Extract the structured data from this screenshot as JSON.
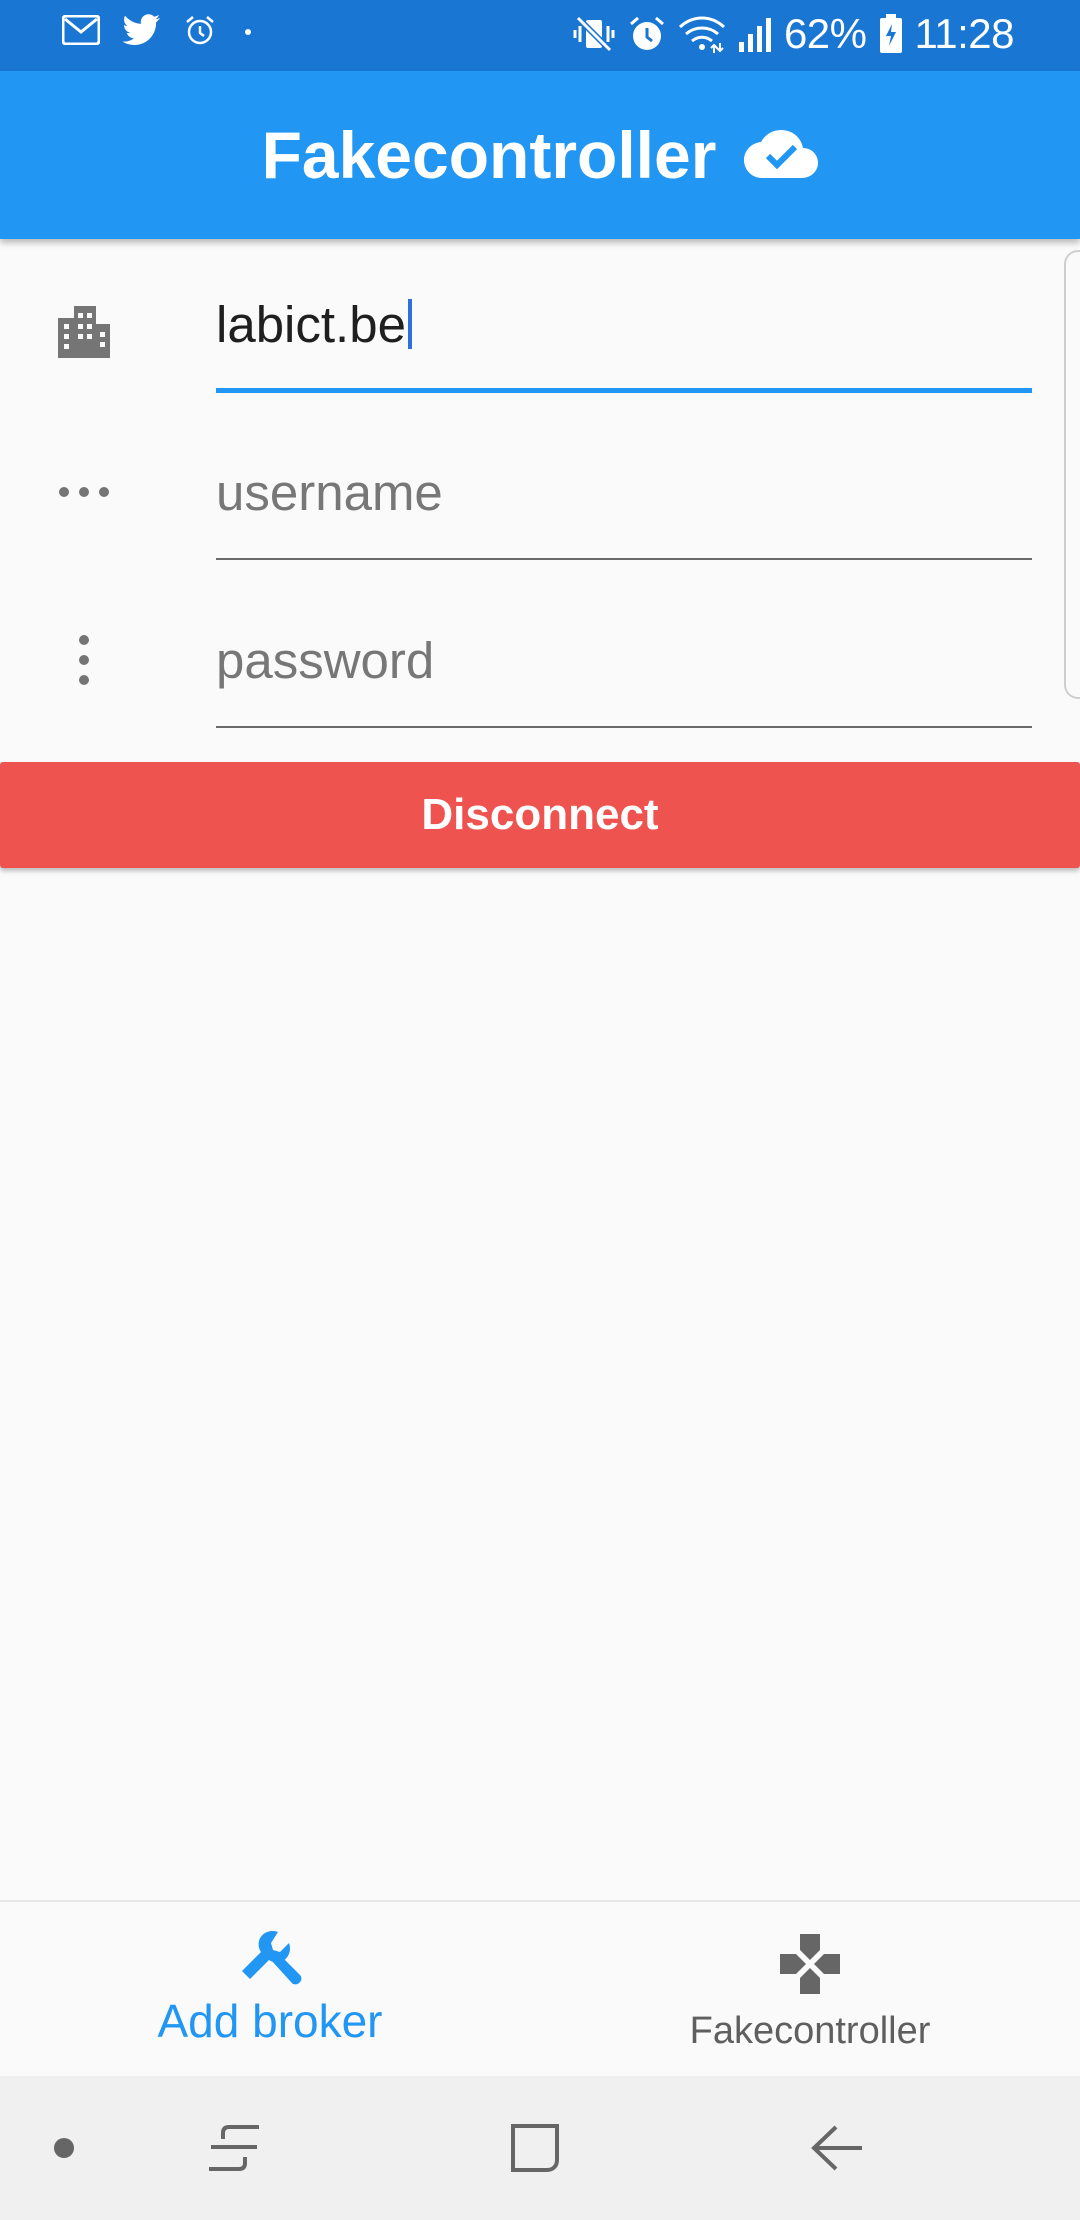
{
  "status_bar": {
    "icons_left": [
      "gmail-icon",
      "twitter-icon",
      "alarm-clock-icon",
      "dot-icon"
    ],
    "icons_right": [
      "mute-vibrate-icon",
      "alarm-icon",
      "wifi-icon",
      "signal-icon"
    ],
    "battery_percent": "62%",
    "time": "11:28",
    "color": "#1976d2"
  },
  "app_bar": {
    "title": "Fakecontroller",
    "status_icon": "cloud-done-icon",
    "color": "#2196f3"
  },
  "form": {
    "broker": {
      "value": "labict.be",
      "icon": "building-icon"
    },
    "username": {
      "placeholder": "username",
      "icon": "more-horizontal-icon"
    },
    "password": {
      "placeholder": "password",
      "icon": "more-vertical-icon"
    }
  },
  "disconnect_button": {
    "label": "Disconnect",
    "color": "#ef5350"
  },
  "bottom_nav": {
    "items": [
      {
        "label": "Add broker",
        "icon": "wrench-icon",
        "active": true
      },
      {
        "label": "Fakecontroller",
        "icon": "gamepad-icon",
        "active": false
      }
    ]
  },
  "system_nav": {
    "buttons": [
      "dot-button",
      "recent-apps-button",
      "home-button",
      "back-button"
    ]
  }
}
